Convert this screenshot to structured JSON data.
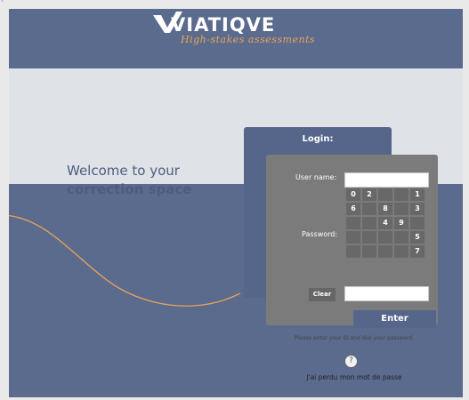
{
  "corner_mark": "⌐",
  "brand": {
    "logo": "VIATIQVE",
    "tagline": "High-stakes assessments"
  },
  "welcome": {
    "line1": "Welcome to your",
    "line2": "correction space"
  },
  "login": {
    "title": "Login:",
    "username_label": "User name:",
    "username_value": "",
    "password_label": "Password:",
    "password_value": "",
    "keypad": [
      [
        "0",
        "2",
        "",
        "",
        "1"
      ],
      [
        "6",
        "",
        "8",
        "",
        "3"
      ],
      [
        "",
        "",
        "4",
        "9",
        ""
      ],
      [
        "",
        "",
        "",
        "",
        "5"
      ],
      [
        "",
        "",
        "",
        "",
        "7"
      ]
    ],
    "clear_label": "Clear",
    "enter_label": "Enter"
  },
  "hint": "Please enter your ID and dial your password.",
  "help_icon": "?",
  "forgot_link": "J'ai perdu mon mot de passe",
  "colors": {
    "brand_blue": "#5b6b8e",
    "accent_orange": "#e8a358",
    "panel_gray": "#7b7b7b"
  },
  "icons": {
    "help": "question-circle-icon"
  }
}
